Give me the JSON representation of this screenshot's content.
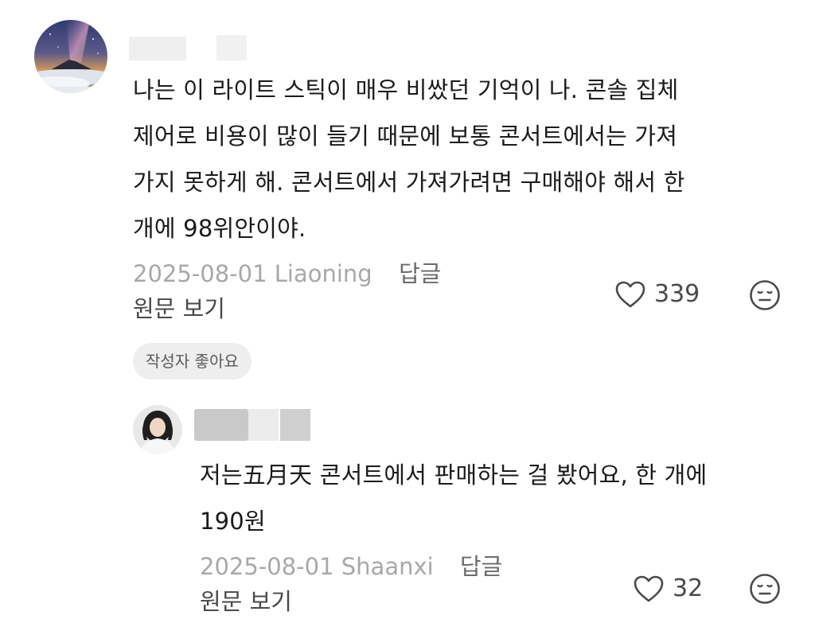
{
  "comment": {
    "lines": [
      "나는 이 라이트 스틱이 매우 비쌌던 기억이 나. 콘솔 집체",
      "제어로 비용이 많이 들기 때문에 보통 콘서트에서는 가져",
      "가지 못하게 해. 콘서트에서 가져가려면 구매해야 해서 한",
      "개에 98위안이야."
    ],
    "date": "2025-08-01",
    "location": "Liaoning",
    "reply_label": "답글",
    "view_original": "원문 보기",
    "likes": "339",
    "author_liked_badge": "작성자 좋아요"
  },
  "reply": {
    "lines": [
      "저는五月天 콘서트에서 판매하는 걸 봤어요, 한 개에",
      "190원"
    ],
    "date": "2025-08-01",
    "location": "Shaanxi",
    "reply_label": "답글",
    "view_original": "원문 보기",
    "likes": "32"
  },
  "icons": {
    "like": "heart-outline-icon",
    "dislike": "meh-face-icon"
  },
  "colors": {
    "text": "#1b1b1b",
    "meta": "#a8a8a8",
    "badge_bg": "#eeeeee"
  }
}
